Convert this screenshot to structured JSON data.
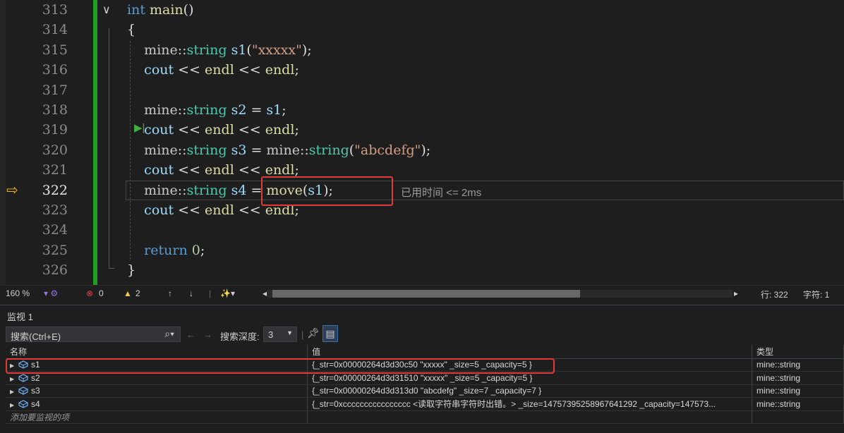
{
  "editor": {
    "lines": [
      {
        "num": "313",
        "code": [
          [
            "kw",
            "int"
          ],
          [
            "txt",
            " "
          ],
          [
            "fn",
            "main"
          ],
          [
            "txt",
            "()"
          ]
        ]
      },
      {
        "num": "314",
        "code": [
          [
            "txt",
            "{"
          ]
        ]
      },
      {
        "num": "315",
        "code": [
          [
            "txt",
            "    "
          ],
          [
            "ns",
            "mine::"
          ],
          [
            "tp",
            "string"
          ],
          [
            "txt",
            " "
          ],
          [
            "vr",
            "s1"
          ],
          [
            "txt",
            "("
          ],
          [
            "str",
            "\"xxxxx\""
          ],
          [
            "txt",
            ");"
          ]
        ]
      },
      {
        "num": "316",
        "code": [
          [
            "txt",
            "    "
          ],
          [
            "vr",
            "cout"
          ],
          [
            "txt",
            " << "
          ],
          [
            "fn",
            "endl"
          ],
          [
            "txt",
            " << "
          ],
          [
            "fn",
            "endl"
          ],
          [
            "txt",
            ";"
          ]
        ]
      },
      {
        "num": "317",
        "code": []
      },
      {
        "num": "318",
        "code": [
          [
            "txt",
            "    "
          ],
          [
            "ns",
            "mine::"
          ],
          [
            "tp",
            "string"
          ],
          [
            "txt",
            " "
          ],
          [
            "vr",
            "s2"
          ],
          [
            "txt",
            " = "
          ],
          [
            "vr",
            "s1"
          ],
          [
            "txt",
            ";"
          ]
        ]
      },
      {
        "num": "319",
        "code": [
          [
            "txt",
            "    "
          ],
          [
            "vr",
            "cout"
          ],
          [
            "txt",
            " << "
          ],
          [
            "fn",
            "endl"
          ],
          [
            "txt",
            " << "
          ],
          [
            "fn",
            "endl"
          ],
          [
            "txt",
            ";"
          ]
        ]
      },
      {
        "num": "320",
        "code": [
          [
            "txt",
            "    "
          ],
          [
            "ns",
            "mine::"
          ],
          [
            "tp",
            "string"
          ],
          [
            "txt",
            " "
          ],
          [
            "vr",
            "s3"
          ],
          [
            "txt",
            " = "
          ],
          [
            "ns",
            "mine::"
          ],
          [
            "tp",
            "string"
          ],
          [
            "txt",
            "("
          ],
          [
            "str",
            "\"abcdefg\""
          ],
          [
            "txt",
            ");"
          ]
        ]
      },
      {
        "num": "321",
        "code": [
          [
            "txt",
            "    "
          ],
          [
            "vr",
            "cout"
          ],
          [
            "txt",
            " << "
          ],
          [
            "fn",
            "endl"
          ],
          [
            "txt",
            " << "
          ],
          [
            "fn",
            "endl"
          ],
          [
            "txt",
            ";"
          ]
        ]
      },
      {
        "num": "322",
        "code": [
          [
            "txt",
            "    "
          ],
          [
            "ns",
            "mine::"
          ],
          [
            "tp",
            "string"
          ],
          [
            "txt",
            " "
          ],
          [
            "vr",
            "s4"
          ],
          [
            "txt",
            " = "
          ],
          [
            "fn",
            "move"
          ],
          [
            "txt",
            "("
          ],
          [
            "vr",
            "s1"
          ],
          [
            "txt",
            ");"
          ]
        ]
      },
      {
        "num": "323",
        "code": [
          [
            "txt",
            "    "
          ],
          [
            "vr",
            "cout"
          ],
          [
            "txt",
            " << "
          ],
          [
            "fn",
            "endl"
          ],
          [
            "txt",
            " << "
          ],
          [
            "fn",
            "endl"
          ],
          [
            "txt",
            ";"
          ]
        ]
      },
      {
        "num": "324",
        "code": []
      },
      {
        "num": "325",
        "code": [
          [
            "txt",
            "    "
          ],
          [
            "kw",
            "return"
          ],
          [
            "txt",
            " "
          ],
          [
            "num",
            "0"
          ],
          [
            "txt",
            ";"
          ]
        ]
      },
      {
        "num": "326",
        "code": [
          [
            "txt",
            "}"
          ]
        ]
      }
    ],
    "current_line": "322",
    "perf_tip": "已用时间 <= 2ms"
  },
  "status": {
    "zoom": "160 %",
    "errors": "0",
    "warnings": "2",
    "line": "行: 322",
    "col": "字符: 1"
  },
  "watch": {
    "title": "监视 1",
    "search_placeholder": "搜索(Ctrl+E)",
    "search_depth_label": "搜索深度:",
    "search_depth_value": "3",
    "columns": {
      "name": "名称",
      "value": "值",
      "type": "类型"
    },
    "rows": [
      {
        "name": "s1",
        "value": "{_str=0x00000264d3d30c50 \"xxxxx\" _size=5 _capacity=5 }",
        "type": "mine::string"
      },
      {
        "name": "s2",
        "value": "{_str=0x00000264d3d31510 \"xxxxx\" _size=5 _capacity=5 }",
        "type": "mine::string"
      },
      {
        "name": "s3",
        "value": "{_str=0x00000264d3d313d0 \"abcdefg\" _size=7 _capacity=7 }",
        "type": "mine::string"
      },
      {
        "name": "s4",
        "value": "{_str=0xcccccccccccccccc <读取字符串字符时出错。> _size=14757395258967641292 _capacity=147573...",
        "type": "mine::string"
      }
    ],
    "add_item": "添加要监视的项"
  },
  "colors": {
    "accent_red": "#e23a3a",
    "change_bar": "#1f9d1f",
    "exec_arrow": "#f5b80c"
  }
}
